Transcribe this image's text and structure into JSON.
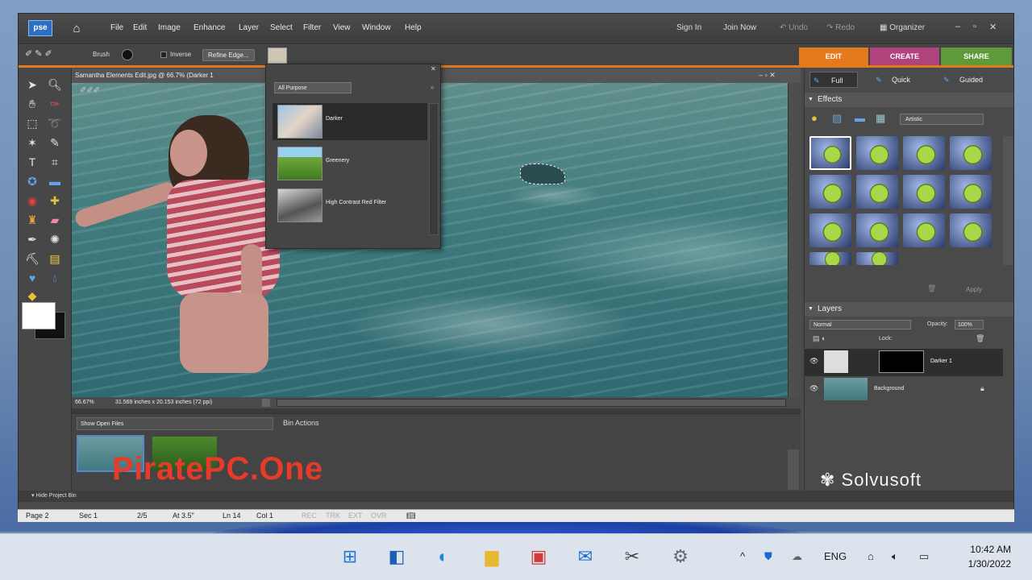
{
  "menubar": {
    "logo": "pse",
    "items": [
      "File",
      "Edit",
      "Image",
      "Enhance",
      "Layer",
      "Select",
      "Filter",
      "View",
      "Window",
      "Help"
    ],
    "sign_in": "Sign In",
    "join_now": "Join Now",
    "undo": "Undo",
    "redo": "Redo",
    "organizer": "Organizer"
  },
  "optionsbar": {
    "brush_label": "Brush",
    "inverse_label": "Inverse",
    "refine_edge": "Refine Edge..."
  },
  "modes": {
    "edit": "EDIT",
    "create": "CREATE",
    "share": "SHARE"
  },
  "document": {
    "title": "Samantha Elements Edit.jpg @ 66.7% (Darker 1",
    "zoom": "66.67%",
    "size": "31.569 inches x 20.153 inches (72 ppi)"
  },
  "filter_popup": {
    "category": "All Purpose",
    "items": [
      {
        "label": "Darker"
      },
      {
        "label": "Greenery"
      },
      {
        "label": "High Contrast Red Filter"
      }
    ]
  },
  "bin": {
    "show": "Show Open Files",
    "actions": "Bin Actions",
    "hide": "Hide Project Bin"
  },
  "watermark": "PiratePC.One",
  "right_panel": {
    "tabs": [
      "Full",
      "Quick",
      "Guided"
    ],
    "effects_title": "Effects",
    "effects_category": "Artistic",
    "apply": "Apply",
    "layers_title": "Layers",
    "blend_mode": "Normal",
    "opacity_label": "Opacity:",
    "opacity_value": "100%",
    "lock_label": "Lock:",
    "layers": [
      {
        "name": "Darker 1"
      },
      {
        "name": "Background"
      }
    ],
    "solvusoft": "Solvusoft"
  },
  "pagebar": {
    "page": "Page 2",
    "sec": "Sec 1",
    "pages": "2/5",
    "at": "At 3.5\"",
    "ln": "Ln 14",
    "col": "Col 1",
    "flags": [
      "REC",
      "TRK",
      "EXT",
      "OVR"
    ]
  },
  "taskbar": {
    "lang": "ENG",
    "time": "10:42 AM",
    "date": "1/30/2022"
  },
  "colors": {
    "accent": "#e07a1c",
    "edit_tab": "#e47a1e",
    "create_tab": "#b0437c",
    "share_tab": "#5e9a3a",
    "watermark": "#e63a2a"
  }
}
